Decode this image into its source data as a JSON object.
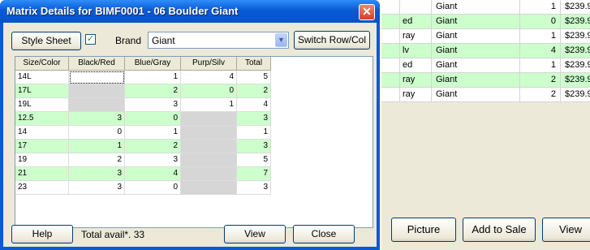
{
  "background_window": {
    "rows": [
      {
        "c0": "",
        "brand": "Giant",
        "qty": "1",
        "price": "$239.95",
        "highlight": false
      },
      {
        "c0": "ed",
        "brand": "Giant",
        "qty": "0",
        "price": "$239.95",
        "highlight": true
      },
      {
        "c0": "ray",
        "brand": "Giant",
        "qty": "1",
        "price": "$239.95",
        "highlight": false
      },
      {
        "c0": "lv",
        "brand": "Giant",
        "qty": "4",
        "price": "$239.95",
        "highlight": true
      },
      {
        "c0": "ed",
        "brand": "Giant",
        "qty": "1",
        "price": "$239.95",
        "highlight": false
      },
      {
        "c0": "ray",
        "brand": "Giant",
        "qty": "2",
        "price": "$239.95",
        "highlight": true
      },
      {
        "c0": "ray",
        "brand": "Giant",
        "qty": "2",
        "price": "$239.95",
        "highlight": false
      }
    ],
    "buttons": {
      "picture": "Picture",
      "add_to_sale": "Add to Sale",
      "view": "View"
    }
  },
  "dialog": {
    "title": "Matrix Details for BIMF0001 - 06 Boulder Giant",
    "close_glyph": "✕",
    "style_sheet_label": "Style Sheet",
    "style_sheet_checked_glyph": "✓",
    "brand_label": "Brand",
    "brand_value": "Giant",
    "switch_label": "Switch Row/Col",
    "matrix": {
      "columns": [
        "Size/Color",
        "Black/Red",
        "Blue/Gray",
        "Purp/Silv",
        "Total"
      ],
      "rows": [
        {
          "size": "14L",
          "cells": [
            "",
            "1",
            "4"
          ],
          "total": "5",
          "na": [
            false,
            false,
            false
          ],
          "sel": [
            true,
            false,
            false
          ],
          "alt": false
        },
        {
          "size": "17L",
          "cells": [
            "",
            "2",
            "0"
          ],
          "total": "2",
          "na": [
            true,
            false,
            false
          ],
          "sel": [
            false,
            false,
            false
          ],
          "alt": true
        },
        {
          "size": "19L",
          "cells": [
            "",
            "3",
            "1"
          ],
          "total": "4",
          "na": [
            true,
            false,
            false
          ],
          "sel": [
            false,
            false,
            false
          ],
          "alt": false
        },
        {
          "size": "12.5",
          "cells": [
            "3",
            "0",
            ""
          ],
          "total": "3",
          "na": [
            false,
            false,
            true
          ],
          "sel": [
            false,
            false,
            false
          ],
          "alt": true
        },
        {
          "size": "14",
          "cells": [
            "0",
            "1",
            ""
          ],
          "total": "1",
          "na": [
            false,
            false,
            true
          ],
          "sel": [
            false,
            false,
            false
          ],
          "alt": false
        },
        {
          "size": "17",
          "cells": [
            "1",
            "2",
            ""
          ],
          "total": "3",
          "na": [
            false,
            false,
            true
          ],
          "sel": [
            false,
            false,
            false
          ],
          "alt": true
        },
        {
          "size": "19",
          "cells": [
            "2",
            "3",
            ""
          ],
          "total": "5",
          "na": [
            false,
            false,
            true
          ],
          "sel": [
            false,
            false,
            false
          ],
          "alt": false
        },
        {
          "size": "21",
          "cells": [
            "3",
            "4",
            ""
          ],
          "total": "7",
          "na": [
            false,
            false,
            true
          ],
          "sel": [
            false,
            false,
            false
          ],
          "alt": true
        },
        {
          "size": "23",
          "cells": [
            "3",
            "0",
            ""
          ],
          "total": "3",
          "na": [
            false,
            false,
            true
          ],
          "sel": [
            false,
            false,
            false
          ],
          "alt": false
        }
      ]
    },
    "help_label": "Help",
    "total_avail": "Total avail*. 33",
    "view_label": "View",
    "close_label": "Close"
  },
  "colors": {
    "titlebar": "#0a5ad6",
    "row_highlight": "#ccffcc",
    "unavailable_cell": "#d6d6d6",
    "close_button": "#d3411e"
  }
}
